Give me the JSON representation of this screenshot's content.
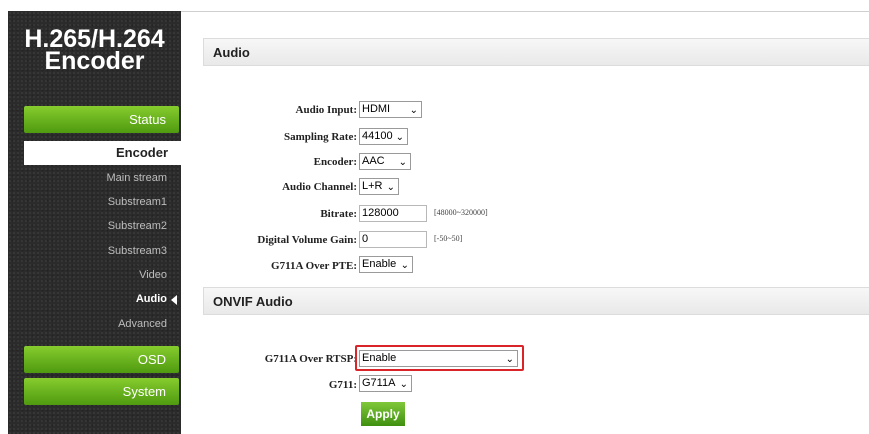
{
  "brand": {
    "line1": "H.265/H.264",
    "line2": "Encoder"
  },
  "nav": {
    "status": "Status",
    "encoder": "Encoder",
    "sub_items": [
      "Main stream",
      "Substream1",
      "Substream2",
      "Substream3",
      "Video",
      "Audio",
      "Advanced"
    ],
    "osd": "OSD",
    "system": "System"
  },
  "audio_section": {
    "title": "Audio",
    "audio_input": {
      "label": "Audio Input:",
      "value": "HDMI"
    },
    "sampling_rate": {
      "label": "Sampling Rate:",
      "value": "44100"
    },
    "encoder": {
      "label": "Encoder:",
      "value": "AAC"
    },
    "audio_channel": {
      "label": "Audio Channel:",
      "value": "L+R"
    },
    "bitrate": {
      "label": "Bitrate:",
      "value": "128000",
      "hint": "[48000~320000]"
    },
    "volume_gain": {
      "label": "Digital Volume Gain:",
      "value": "0",
      "hint": "[-50~50]"
    },
    "g711a_pte": {
      "label": "G711A Over PTE:",
      "value": "Enable"
    }
  },
  "onvif_section": {
    "title": "ONVIF Audio",
    "g711a_rtsp": {
      "label": "G711A Over RTSP:",
      "value": "Enable"
    },
    "g711": {
      "label": "G711:",
      "value": "G711A"
    }
  },
  "apply_label": "Apply",
  "icons": {
    "dropdown": "chevron-down-icon",
    "current": "caret-left-icon"
  },
  "colors": {
    "accent_green": "#5fae1b",
    "highlight_red": "#d9252a",
    "sidebar_bg": "#2b2b2b"
  }
}
